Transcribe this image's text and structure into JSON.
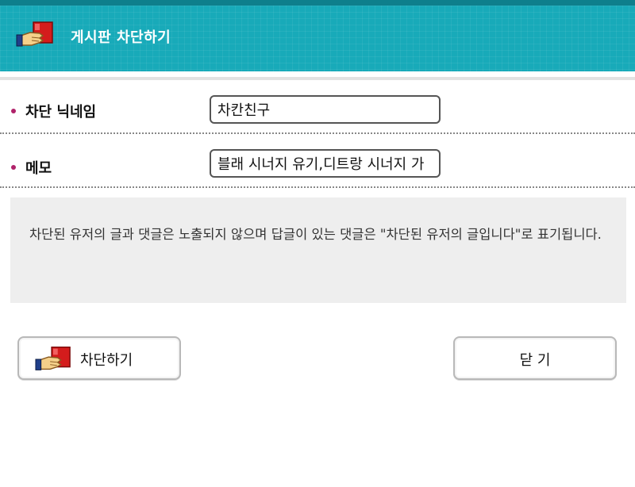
{
  "header": {
    "title": "게시판 차단하기",
    "icon": "block-hand-card-icon"
  },
  "form": {
    "nickname_label": "차단 닉네임",
    "nickname_value": "차칸친구",
    "memo_label": "메모",
    "memo_value": "블래 시너지 유기,디트랑 시너지 가"
  },
  "notice": {
    "text": "차단된 유저의 글과 댓글은 노출되지 않으며 답글이 있는 댓글은 \"차단된 유저의 글입니다\"로 표기됩니다."
  },
  "buttons": {
    "block_label": "차단하기",
    "close_label": "닫 기"
  },
  "colors": {
    "header_bg": "#18aab9",
    "bullet": "#b0226a"
  }
}
